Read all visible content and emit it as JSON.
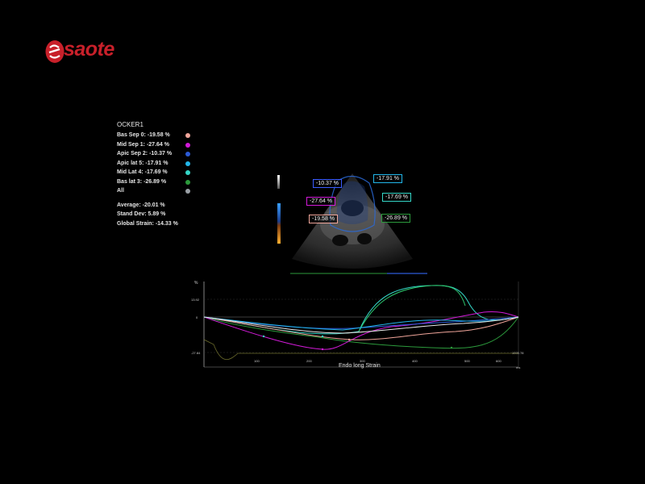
{
  "logo": {
    "text": "saote",
    "color": "#c8202a"
  },
  "panel": {
    "title": "OCKER1",
    "segments": [
      {
        "label": "Bas Sep 0: -19.58 %",
        "color": "#f0a59a"
      },
      {
        "label": "Mid Sep 1: -27.64 %",
        "color": "#d21ad8"
      },
      {
        "label": "Apic Sep 2: -10.37 %",
        "color": "#2c5bd6"
      },
      {
        "label": "Apic lat 5: -17.91 %",
        "color": "#22b6ea"
      },
      {
        "label": "Mid Lat 4: -17.69 %",
        "color": "#34d6c7"
      },
      {
        "label": "Bas lat 3: -26.89 %",
        "color": "#2c9a3c"
      },
      {
        "label": "All",
        "color": "#9aa0a6"
      }
    ],
    "average": "Average: -20.01 %",
    "stand_dev": "Stand Dev: 5.89 %",
    "global_strain": "Global Strain: -14.33 %"
  },
  "echo_labels": [
    {
      "text": "-10.37 %",
      "color": "#3a5cff"
    },
    {
      "text": "-17.91 %",
      "color": "#22b6ea"
    },
    {
      "text": "-17.69 %",
      "color": "#34d6c7"
    },
    {
      "text": "-27.64 %",
      "color": "#d21ad8"
    },
    {
      "text": "-19.58 %",
      "color": "#f0a59a"
    },
    {
      "text": "-26.89 %",
      "color": "#2c9a3c"
    }
  ],
  "plot": {
    "title": "Endo long Strain",
    "y_unit": "%",
    "y_ticks": [
      "13.92",
      "0",
      "-27.84"
    ],
    "x_ticks": [
      "100",
      "200",
      "300",
      "400",
      "500",
      "600"
    ],
    "x_end_label": "1000.78",
    "x_unit": "ms",
    "colors": [
      "#f0a59a",
      "#d21ad8",
      "#2c5bd6",
      "#22b6ea",
      "#34d6c7",
      "#2c9a3c",
      "#cfcfcf"
    ]
  }
}
